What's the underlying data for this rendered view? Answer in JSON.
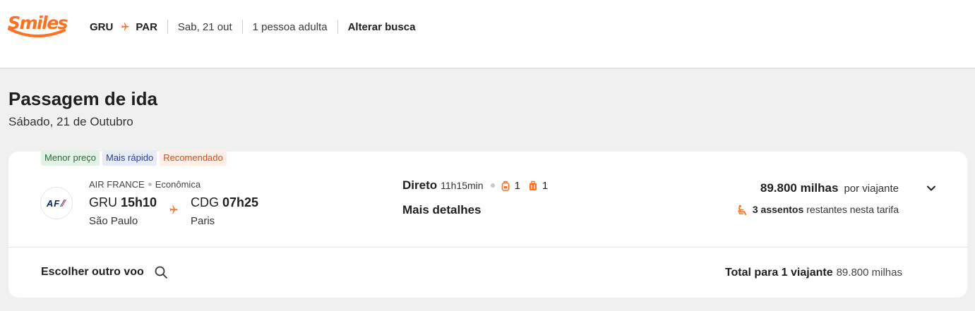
{
  "brand": {
    "logo_text": "Smiles",
    "accent_color": "#ff7020"
  },
  "header": {
    "origin": "GRU",
    "destination": "PAR",
    "date": "Sab, 21 out",
    "passengers": "1 pessoa adulta",
    "change_search": "Alterar busca"
  },
  "page": {
    "title": "Passagem de ida",
    "date": "Sábado, 21 de Outubro"
  },
  "flight": {
    "tags": [
      {
        "label": "Menor preço"
      },
      {
        "label": "Mais rápido"
      },
      {
        "label": "Recomendado"
      }
    ],
    "airline_logo_text": "AF",
    "airline": "AIR FRANCE",
    "cabin": "Econômica",
    "origin_code": "GRU",
    "origin_time": "15h10",
    "origin_city": "São Paulo",
    "destination_code": "CDG",
    "destination_time": "07h25",
    "destination_city": "Paris",
    "stops": "Direto",
    "duration": "11h15min",
    "carry_on_count": "1",
    "checked_bag_count": "1",
    "more_details": "Mais detalhes",
    "price": "89.800 milhas",
    "price_suffix": "por viajante",
    "seats_bold": "3 assentos",
    "seats_rest": "restantes nesta tarifa",
    "other_flight": "Escolher outro voo",
    "total_label": "Total para 1 viajante",
    "total_value": "89.800 milhas"
  },
  "icons": {
    "route_arrow": "plane-icon",
    "carry_on": "backpack-icon",
    "checked_bag": "suitcase-icon",
    "seat": "seat-icon",
    "expand": "chevron-down-icon",
    "search": "search-icon"
  }
}
